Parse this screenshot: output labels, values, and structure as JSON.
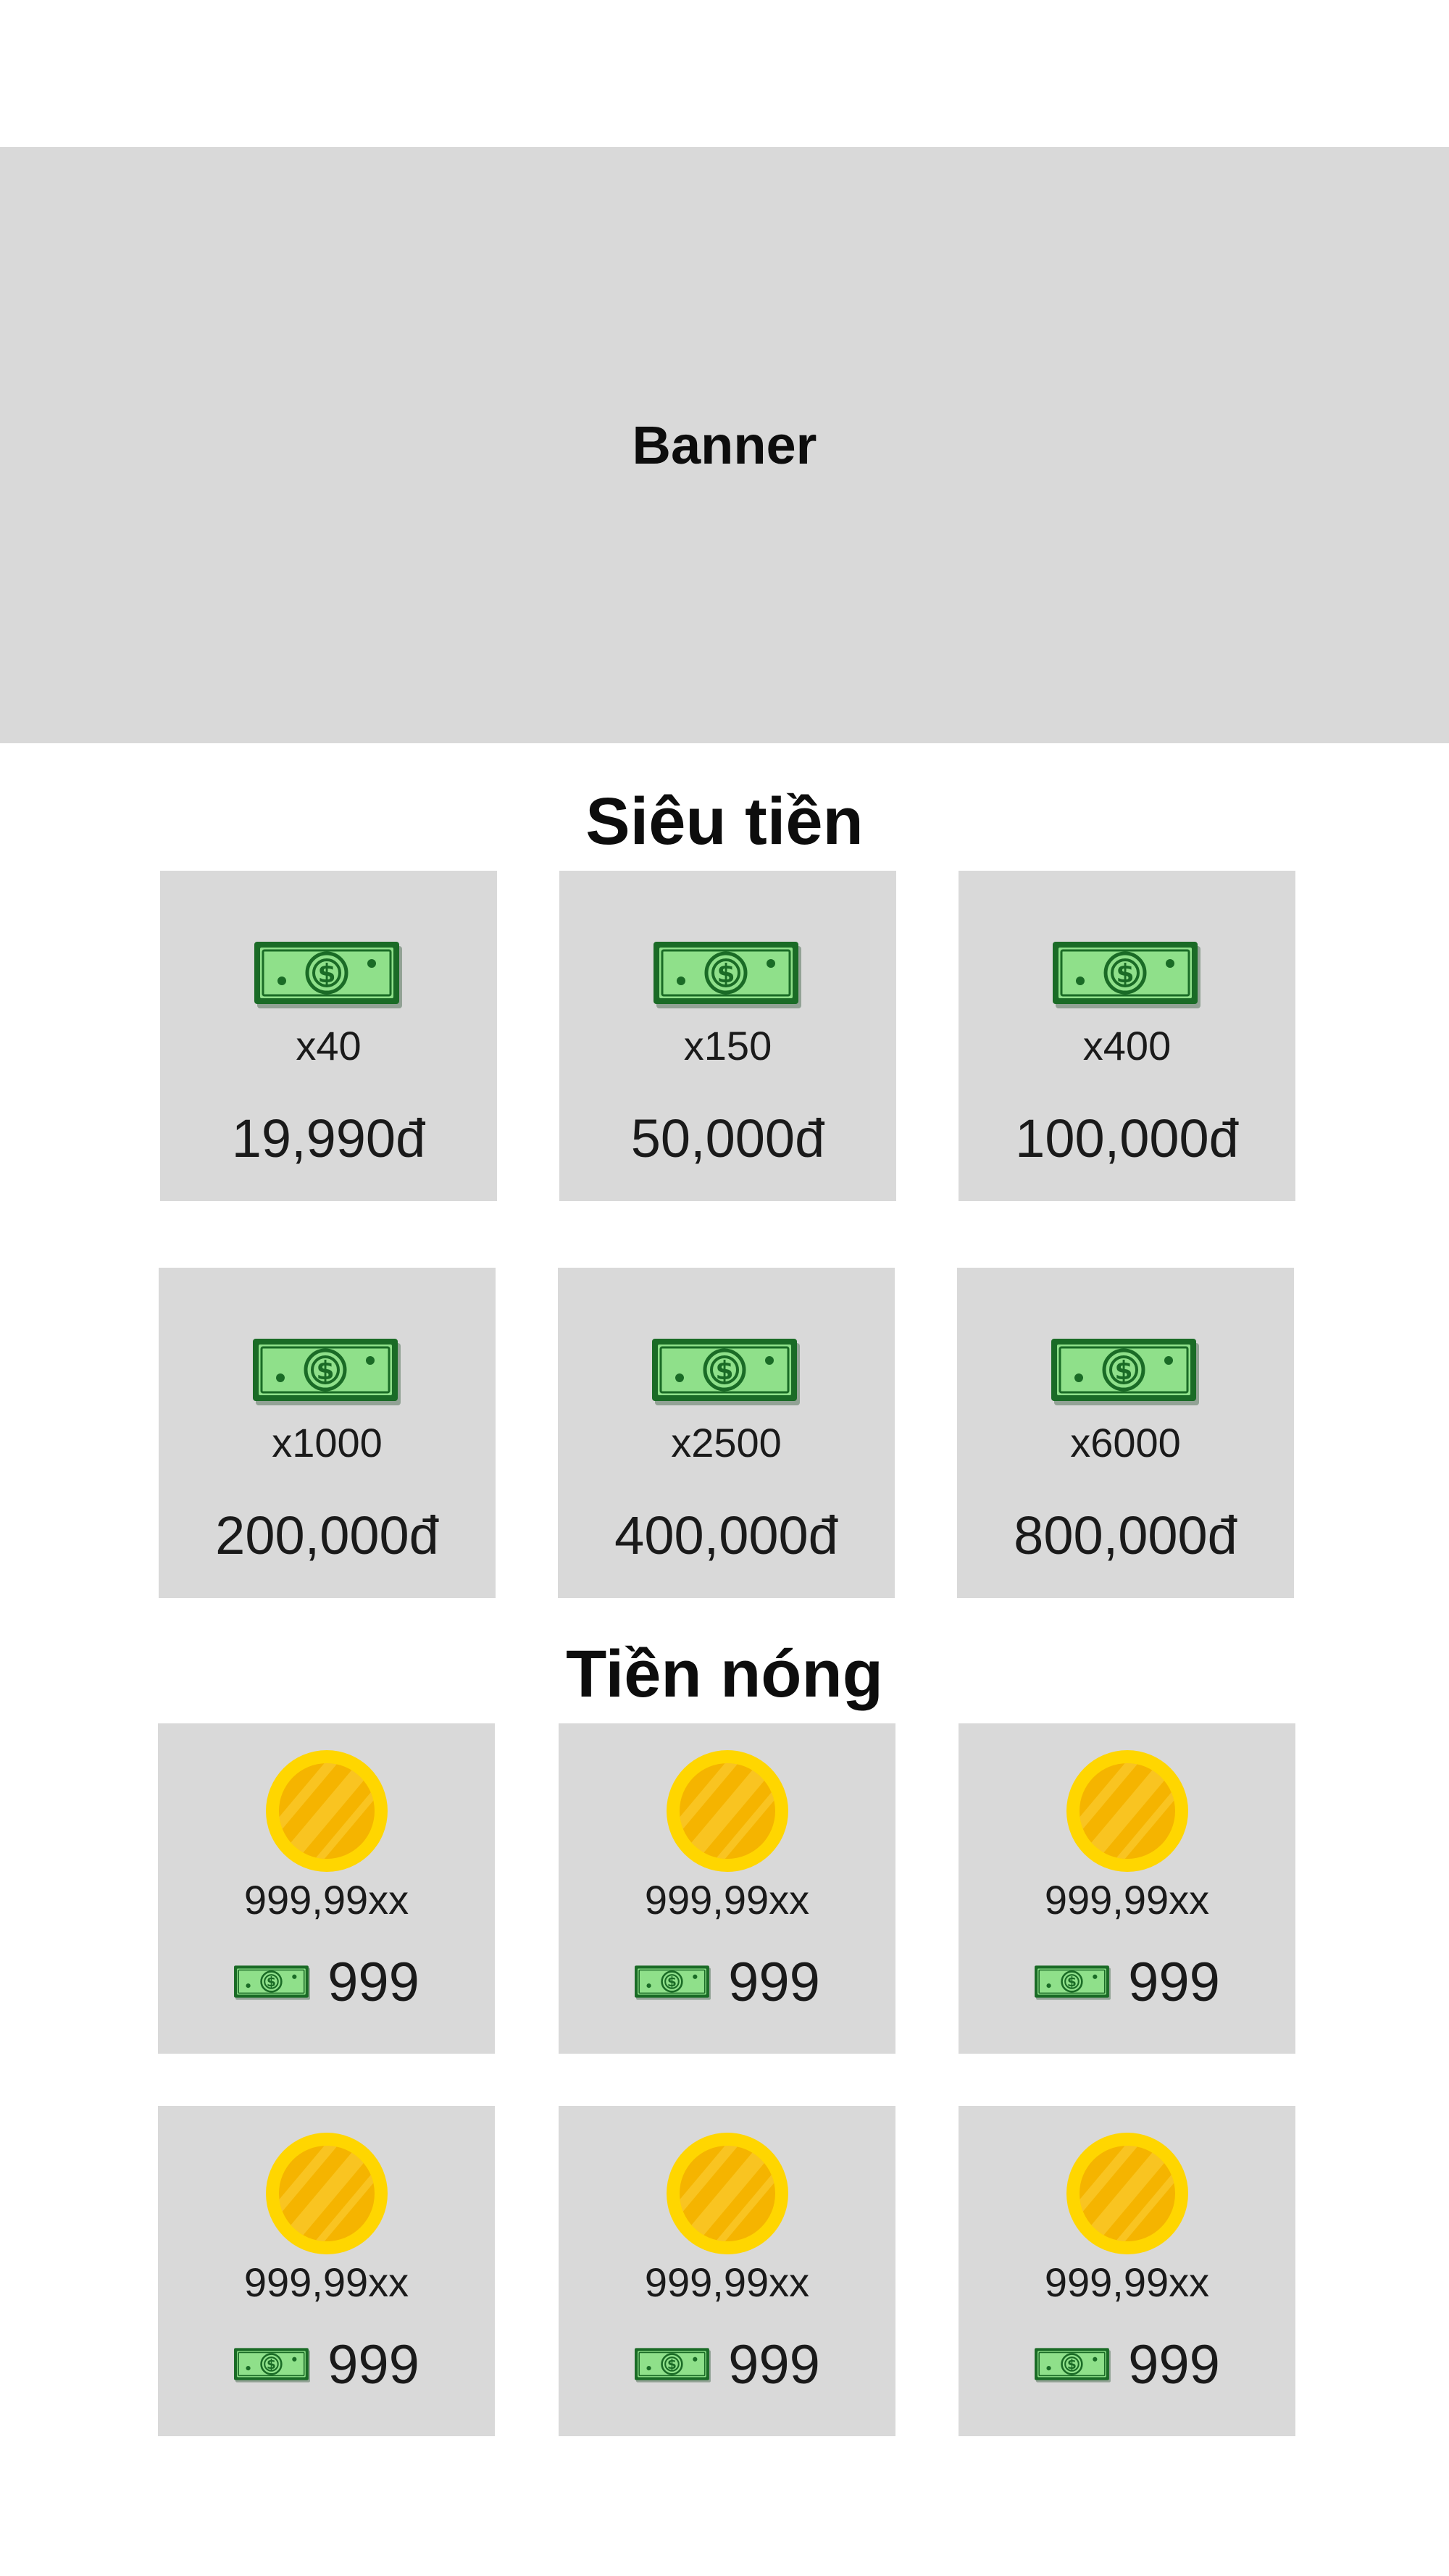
{
  "banner": {
    "label": "Banner"
  },
  "sections": [
    {
      "title": "Siêu tiền",
      "items": [
        {
          "qty": "x40",
          "price": "19,990đ"
        },
        {
          "qty": "x150",
          "price": "50,000đ"
        },
        {
          "qty": "x400",
          "price": "100,000đ"
        },
        {
          "qty": "x1000",
          "price": "200,000đ"
        },
        {
          "qty": "x2500",
          "price": "400,000đ"
        },
        {
          "qty": "x6000",
          "price": "800,000đ"
        }
      ]
    },
    {
      "title": "Tiền nóng",
      "items": [
        {
          "amount": "999,99xx",
          "cost": "999"
        },
        {
          "amount": "999,99xx",
          "cost": "999"
        },
        {
          "amount": "999,99xx",
          "cost": "999"
        },
        {
          "amount": "999,99xx",
          "cost": "999"
        },
        {
          "amount": "999,99xx",
          "cost": "999"
        },
        {
          "amount": "999,99xx",
          "cost": "999"
        }
      ]
    }
  ],
  "icons": {
    "bill": "cash-bill-icon",
    "coin": "gold-coin-icon"
  },
  "colors": {
    "card_bg": "#d9d9d9",
    "bill_green": "#1f8a2e",
    "coin_gold": "#f7c400"
  }
}
